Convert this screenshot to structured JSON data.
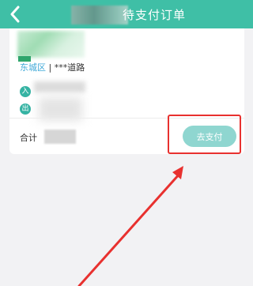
{
  "header": {
    "title": "待支付订单",
    "back_icon": "chevron-left-icon",
    "background_color": "#3fbfa6"
  },
  "order": {
    "address": {
      "district": "东城区",
      "separator": "|",
      "road": "***道路"
    },
    "checkin_badge": "入",
    "checkout_badge": "出",
    "total_label": "合计",
    "pay_button_label": "去支付"
  },
  "annotation": {
    "highlight_color": "#e8312f",
    "arrow_color": "#e8312f"
  }
}
